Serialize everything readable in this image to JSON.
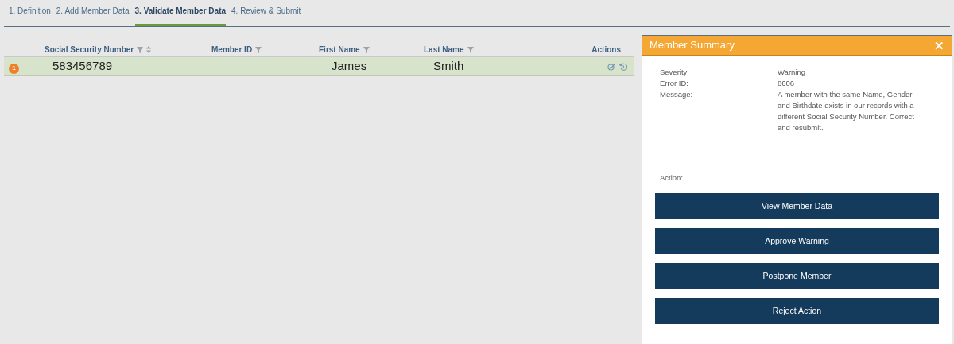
{
  "steps": [
    {
      "label": "1. Definition",
      "selected": false
    },
    {
      "label": "2. Add Member Data",
      "selected": false
    },
    {
      "label": "3. Validate Member Data",
      "selected": true
    },
    {
      "label": "4. Review & Submit",
      "selected": false
    }
  ],
  "table": {
    "columns": [
      {
        "label": "Social Security Number",
        "filter": true,
        "sort": true
      },
      {
        "label": "Member ID",
        "filter": true,
        "sort": false
      },
      {
        "label": "First Name",
        "filter": true,
        "sort": false
      },
      {
        "label": "Last Name",
        "filter": true,
        "sort": false
      },
      {
        "label": "Actions",
        "filter": false,
        "sort": false
      }
    ],
    "rows": [
      {
        "badge": "1",
        "ssn": "583456789",
        "member_id": "",
        "first_name": "James",
        "last_name": "Smith",
        "selected": true
      }
    ]
  },
  "summary": {
    "title": "Member Summary",
    "close": "✕",
    "fields": [
      {
        "label": "Severity:",
        "value": "Warning"
      },
      {
        "label": "Error ID:",
        "value": "8606"
      },
      {
        "label": "Message:",
        "value": "A member with the same Name, Gender and Birthdate exists in our records with a different Social Security Number. Correct and resubmit."
      }
    ],
    "action_label": "Action:",
    "buttons": [
      "View Member Data",
      "Approve Warning",
      "Postpone Member",
      "Reject Action"
    ]
  }
}
